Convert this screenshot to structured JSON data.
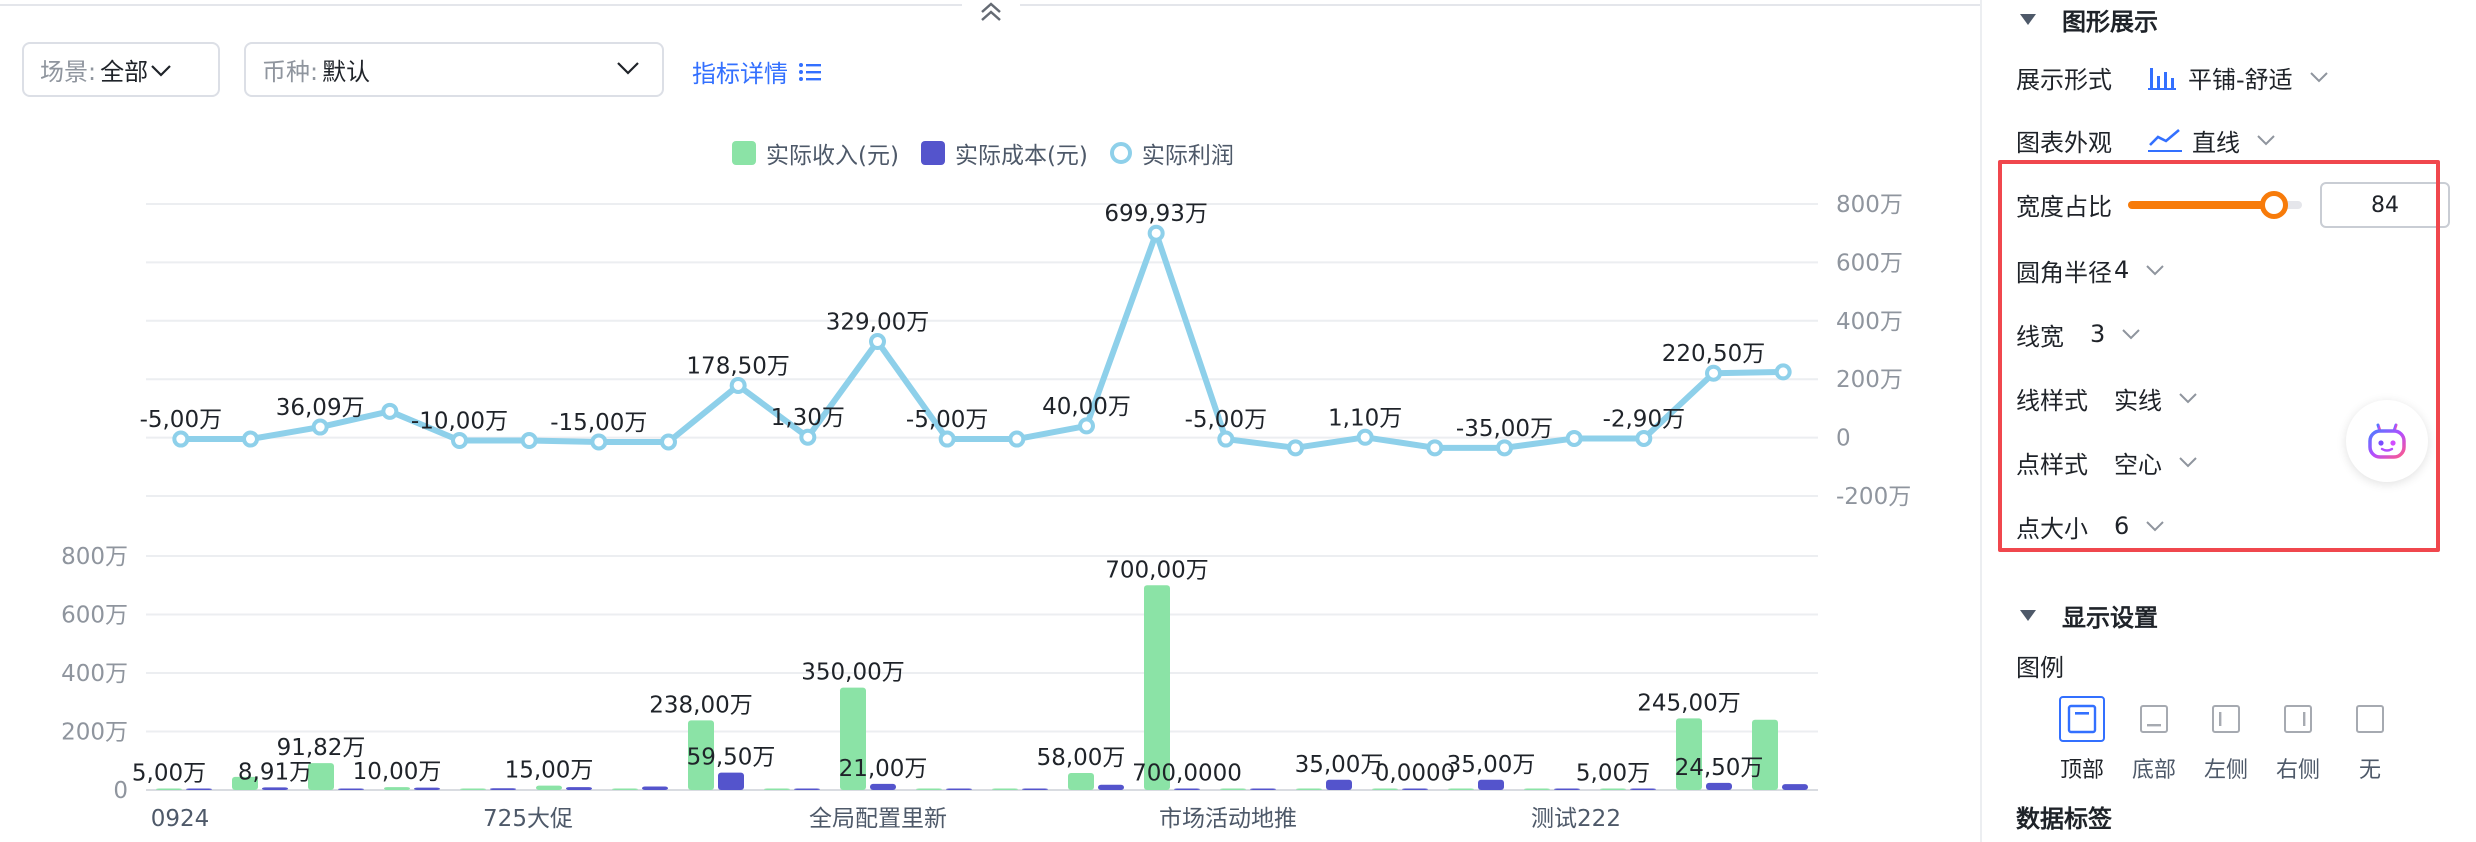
{
  "filters": {
    "scene_label": "场景:",
    "scene_value": "全部",
    "currency_label": "币种:",
    "currency_value": "默认",
    "metric_link": "指标详情"
  },
  "legend": [
    {
      "name": "实际收入(元)",
      "color": "#8be3a6",
      "shape": "square"
    },
    {
      "name": "实际成本(元)",
      "color": "#5454cc",
      "shape": "square"
    },
    {
      "name": "实际利润",
      "color": "#8ed0ea",
      "shape": "ring"
    }
  ],
  "chart_data": [
    {
      "type": "line",
      "series": [
        {
          "name": "实际利润",
          "values": [
            -5,
            -5,
            36.09,
            90,
            -10,
            -10,
            -15,
            -15,
            178.5,
            1.3,
            329,
            -5,
            -5,
            40,
            699.93,
            -5,
            -35,
            1.1,
            -35,
            -35,
            -2.9,
            -2.9,
            220.5,
            225
          ],
          "labels": [
            "-5,00万",
            "",
            "36,09万",
            "",
            "-10,00万",
            "",
            "-15,00万",
            "",
            "178,50万",
            "1,30万",
            "329,00万",
            "-5,00万",
            "",
            "40,00万",
            "699,93万",
            "-5,00万",
            "",
            "1,10万",
            "",
            "-35,00万",
            "",
            "-2,90万",
            "220,50万",
            ""
          ]
        }
      ],
      "y_ticks": [
        "800万",
        "600万",
        "400万",
        "200万",
        "0",
        "-200万"
      ],
      "ylim": [
        -200,
        800
      ],
      "y_axis_side": "right",
      "grid": true
    },
    {
      "type": "bar",
      "categories": [
        "0924",
        "725大促",
        "全局配置里新",
        "市场活动地推",
        "测试222"
      ],
      "series": [
        {
          "name": "实际收入(元)",
          "values": [
            5,
            45,
            91.82,
            10,
            0,
            15,
            0,
            238,
            0,
            350,
            0,
            0,
            58,
            700,
            0,
            5,
            0,
            0,
            5,
            5,
            245,
            240
          ],
          "labels": [
            "5,00万",
            "",
            "91,82万",
            "10,00万",
            "",
            "15,00万",
            "",
            "238,00万",
            "",
            "350,00万",
            "",
            "",
            "58,00万",
            "700,00万",
            "",
            "",
            "",
            "",
            "",
            "5,00万",
            "245,00万",
            ""
          ]
        },
        {
          "name": "实际成本(元)",
          "values": [
            2,
            8.91,
            5,
            8,
            6,
            10,
            12,
            59.5,
            4,
            21,
            3,
            5,
            18,
            0,
            3,
            35,
            0,
            35,
            5,
            5,
            24.5,
            20
          ],
          "labels": [
            "",
            "8,91万",
            "",
            "",
            "",
            "",
            "",
            "59,50万",
            "",
            "21,00万",
            "",
            "",
            "",
            "700,0000",
            "",
            "35,00万",
            "0,0000",
            "35,00万",
            "",
            "",
            "24,50万",
            ""
          ]
        }
      ],
      "y_ticks": [
        "800万",
        "600万",
        "400万",
        "200万",
        "0"
      ],
      "ylim": [
        0,
        800
      ],
      "y_axis_side": "left",
      "grid": true
    }
  ],
  "panel": {
    "graph_section_title": "图形展示",
    "display_form_label": "展示形式",
    "display_form_value": "平铺-舒适",
    "chart_look_label": "图表外观",
    "chart_look_value": "直线",
    "width_ratio_label": "宽度占比",
    "width_ratio_value": "84",
    "width_ratio_fraction": 0.84,
    "corner_radius_label": "圆角半径",
    "corner_radius_value": "4",
    "line_width_label": "线宽",
    "line_width_value": "3",
    "line_style_label": "线样式",
    "line_style_value": "实线",
    "point_style_label": "点样式",
    "point_style_value": "空心",
    "point_size_label": "点大小",
    "point_size_value": "6",
    "display_section_title": "显示设置",
    "legend_label": "图例",
    "legend_positions": [
      "顶部",
      "底部",
      "左侧",
      "右侧",
      "无"
    ],
    "legend_position_selected": "顶部",
    "data_label_title": "数据标签",
    "accent_color": "#3370ff",
    "slider_color": "#f77b0a",
    "highlight_color": "#f0474d"
  }
}
